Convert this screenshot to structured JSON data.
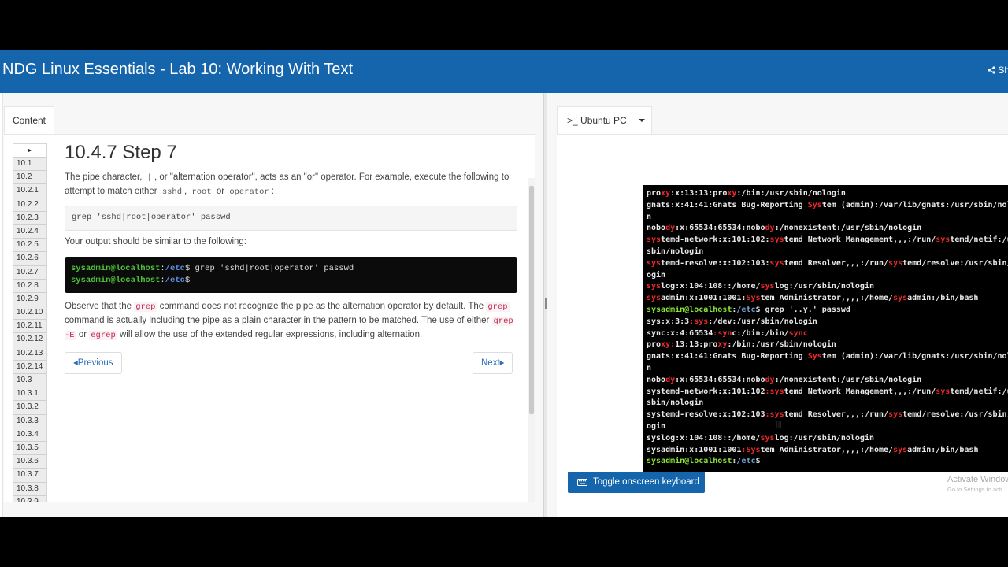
{
  "header": {
    "title": "NDG Linux Essentials - Lab 10: Working With Text",
    "share_label": "Sh"
  },
  "left": {
    "tab_label": "Content",
    "nav_items": [
      "10.1",
      "10.2",
      "10.2.1",
      "10.2.2",
      "10.2.3",
      "10.2.4",
      "10.2.5",
      "10.2.6",
      "10.2.7",
      "10.2.8",
      "10.2.9",
      "10.2.10",
      "10.2.11",
      "10.2.12",
      "10.2.13",
      "10.2.14",
      "10.3",
      "10.3.1",
      "10.3.2",
      "10.3.3",
      "10.3.4",
      "10.3.5",
      "10.3.6",
      "10.3.7",
      "10.3.8",
      "10.3.9"
    ],
    "step": {
      "title": "10.4.7 Step 7",
      "p1_a": "The pipe character,",
      "p1_pipe": "|",
      "p1_b": ", or \"alternation operator\", acts as an \"or\" operator. For example, execute the following to attempt to match either",
      "p1_sshd": "sshd",
      "p1_comma": ",",
      "p1_root": "root",
      "p1_or": "or",
      "p1_operator": "operator",
      "p1_colon": ":",
      "command": "grep 'sshd|root|operator' passwd",
      "p2": "Your output should be similar to the following:",
      "output_user": "sysadmin@localhost",
      "output_colon": ":",
      "output_path": "/etc",
      "output_cmd": "$ grep 'sshd|root|operator' passwd",
      "output_prompt_end": "$",
      "p3_a": "Observe that the",
      "p3_grep1": "grep",
      "p3_b": "command does not recognize the pipe as the alternation operator by default. The",
      "p3_grep2": "grep",
      "p3_c": "command is actually including the pipe as a plain character in the pattern to be matched. The use of either",
      "p3_grepE": "grep -E",
      "p3_or": "or",
      "p3_egrep": "egrep",
      "p3_d": "will allow the use of the extended regular expressions, including alternation.",
      "prev_label": "Previous",
      "next_label": "Next"
    }
  },
  "right": {
    "tab_label": "Ubuntu PC",
    "tab_prefix": ">_",
    "keyboard_button": "Toggle onscreen keyboard",
    "watermark_line1": "Activate Window",
    "watermark_line2": "Go to Settings to acti",
    "terminal_lines": [
      [
        [
          "pro",
          ""
        ],
        [
          "xy",
          "hl"
        ],
        [
          ":x:13:13:pro",
          ""
        ],
        [
          "xy",
          "hl"
        ],
        [
          ":/bin:/usr/sbin/nologin",
          ""
        ]
      ],
      [
        [
          "gnats:x:41:41:Gnats Bug-Reporting ",
          ""
        ],
        [
          "Sys",
          "hl"
        ],
        [
          "tem (admin):/var/lib/gnats:/usr/sbin/nologi",
          ""
        ]
      ],
      [
        [
          "n",
          ""
        ]
      ],
      [
        [
          "nobo",
          ""
        ],
        [
          "dy",
          "hl"
        ],
        [
          ":x:65534:65534:nobo",
          ""
        ],
        [
          "dy",
          "hl"
        ],
        [
          ":/nonexistent:/usr/sbin/nologin",
          ""
        ]
      ],
      [
        [
          "sys",
          "hl"
        ],
        [
          "temd-network:x:101:102:",
          ""
        ],
        [
          "sys",
          "hl"
        ],
        [
          "temd Network Management,,,:/run/",
          ""
        ],
        [
          "sys",
          "hl"
        ],
        [
          "temd/netif:/usr/",
          ""
        ]
      ],
      [
        [
          "sbin/nologin",
          ""
        ]
      ],
      [
        [
          "sys",
          "hl"
        ],
        [
          "temd-resolve:x:102:103:",
          ""
        ],
        [
          "sys",
          "hl"
        ],
        [
          "temd Resolver,,,:/run/",
          ""
        ],
        [
          "sys",
          "hl"
        ],
        [
          "temd/resolve:/usr/sbin/nol",
          ""
        ]
      ],
      [
        [
          "ogin",
          ""
        ]
      ],
      [
        [
          "sys",
          "hl"
        ],
        [
          "log:x:104:108::/home/",
          ""
        ],
        [
          "sys",
          "hl"
        ],
        [
          "log:/usr/sbin/nologin",
          ""
        ]
      ],
      [
        [
          "sys",
          "hl"
        ],
        [
          "admin:x:1001:1001:",
          ""
        ],
        [
          "Sys",
          "hl"
        ],
        [
          "tem Administrator,,,,:/home/",
          ""
        ],
        [
          "sys",
          "hl"
        ],
        [
          "admin:/bin/bash",
          ""
        ]
      ],
      [
        [
          "sysadmin@localhost",
          "tp"
        ],
        [
          ":",
          ""
        ],
        [
          "/etc",
          "tb"
        ],
        [
          "$ grep '..y.' passwd",
          ""
        ]
      ],
      [
        [
          "sys:x:3:3",
          ""
        ],
        [
          ":sys",
          "hl"
        ],
        [
          ":/dev:/usr/sbin/nologin",
          ""
        ]
      ],
      [
        [
          "sync:x:4:65534",
          ""
        ],
        [
          ":syn",
          "hl"
        ],
        [
          "c:/bin:/bin/",
          ""
        ],
        [
          "sync",
          "hl"
        ]
      ],
      [
        [
          "pro",
          ""
        ],
        [
          "xy:",
          "hl"
        ],
        [
          "13:13:pro",
          ""
        ],
        [
          "xy",
          "hl"
        ],
        [
          ":/bin:/usr/sbin/nologin",
          ""
        ]
      ],
      [
        [
          "gnats:x:41:41:Gnats Bug-Reporting ",
          ""
        ],
        [
          "Sys",
          "hl"
        ],
        [
          "tem (admin):/var/lib/gnats:/usr/sbin/nologi",
          ""
        ]
      ],
      [
        [
          "n",
          ""
        ]
      ],
      [
        [
          "nobo",
          ""
        ],
        [
          "dy",
          "hl"
        ],
        [
          ":x:65534:65534:nobo",
          ""
        ],
        [
          "dy",
          "hl"
        ],
        [
          ":/nonexistent:/usr/sbin/nologin",
          ""
        ]
      ],
      [
        [
          "systemd-network:x:101:102",
          ""
        ],
        [
          ":sys",
          "hl"
        ],
        [
          "temd Network Management,,,:/run/",
          ""
        ],
        [
          "sys",
          "hl"
        ],
        [
          "temd/netif:/usr/",
          ""
        ]
      ],
      [
        [
          "sbin/nologin",
          ""
        ]
      ],
      [
        [
          "systemd-resolve:x:102:103",
          ""
        ],
        [
          ":sys",
          "hl"
        ],
        [
          "temd Resolver,,,:/run/",
          ""
        ],
        [
          "sys",
          "hl"
        ],
        [
          "temd/resolve:/usr/sbin/nol",
          ""
        ]
      ],
      [
        [
          "ogin",
          ""
        ]
      ],
      [
        [
          "syslog:x:104:108::/home/",
          ""
        ],
        [
          "sys",
          "hl"
        ],
        [
          "log:/usr/sbin/nologin",
          ""
        ]
      ],
      [
        [
          "sysadmin:x:1001:1001",
          ""
        ],
        [
          ":Sys",
          "hl"
        ],
        [
          "tem Administrator,,,,:/home/",
          ""
        ],
        [
          "sys",
          "hl"
        ],
        [
          "admin:/bin/bash",
          ""
        ]
      ],
      [
        [
          "sysadmin@localhost",
          "tp"
        ],
        [
          ":",
          ""
        ],
        [
          "/etc",
          "tb"
        ],
        [
          "$",
          ""
        ]
      ]
    ]
  }
}
